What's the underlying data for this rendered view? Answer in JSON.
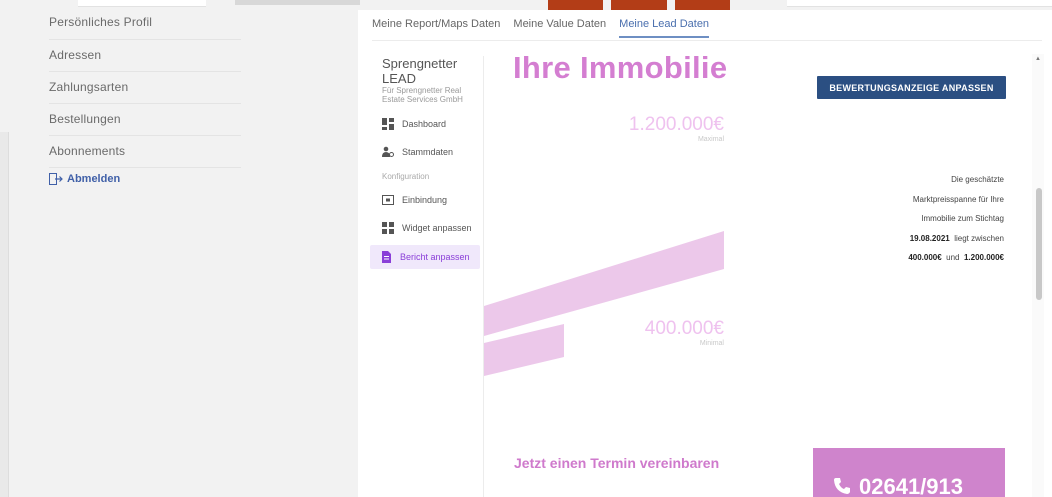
{
  "account_nav": {
    "items": [
      {
        "label": "Persönliches Profil"
      },
      {
        "label": "Adressen"
      },
      {
        "label": "Zahlungsarten"
      },
      {
        "label": "Bestellungen"
      },
      {
        "label": "Abonnements"
      }
    ],
    "logout_label": "Abmelden"
  },
  "tabs": [
    {
      "label": "Meine Report/Maps Daten",
      "active": false
    },
    {
      "label": "Meine Value Daten",
      "active": false
    },
    {
      "label": "Meine Lead Daten",
      "active": true
    }
  ],
  "sidebar": {
    "brand_title_1": "Sprengnetter",
    "brand_title_2": "LEAD",
    "brand_sub_1": "Für Sprengnetter Real",
    "brand_sub_2": "Estate Services GmbH",
    "items": [
      {
        "label": "Dashboard",
        "icon": "dashboard-icon"
      },
      {
        "label": "Stammdaten",
        "icon": "users-icon"
      }
    ],
    "section_label": "Konfiguration",
    "config_items": [
      {
        "label": "Einbindung",
        "icon": "embed-icon"
      },
      {
        "label": "Widget anpassen",
        "icon": "widget-icon"
      },
      {
        "label": "Bericht anpassen",
        "icon": "report-icon",
        "active": true
      }
    ]
  },
  "report": {
    "title": "Ihre Immobilie",
    "adjust_button": "BEWERTUNGSANZEIGE ANPASSEN",
    "max_price": "1.200.000€",
    "max_label": "Maximal",
    "min_price": "400.000€",
    "min_label": "Minimal",
    "desc_1": "Die geschätzte",
    "desc_2": "Marktpreisspanne für Ihre",
    "desc_3": "Immobilie zum Stichtag",
    "desc_date": "19.08.2021",
    "desc_4": "liegt zwischen",
    "desc_min": "400.000€",
    "desc_und": "und",
    "desc_max": "1.200.000€",
    "cta": "Jetzt einen Termin vereinbaren",
    "phone": "02641/913"
  },
  "colors": {
    "accent_pink": "#d47ed1",
    "button_blue": "#2b4f82",
    "link_blue": "#4a6fae",
    "active_purple": "#8a3fd8"
  }
}
